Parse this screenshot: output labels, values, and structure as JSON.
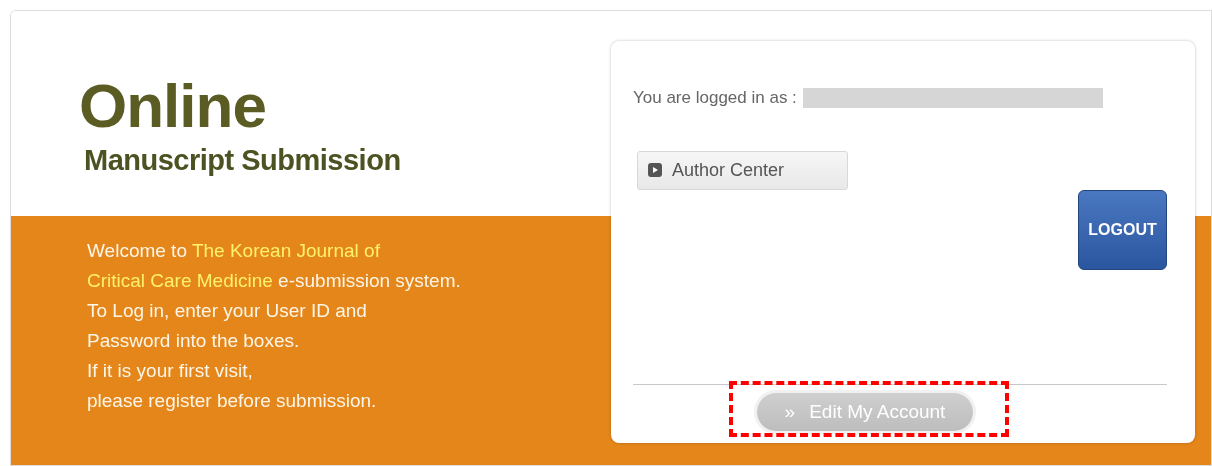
{
  "header": {
    "title": "Online",
    "subtitle": "Manuscript Submission"
  },
  "welcome": [
    [
      {
        "text": "Welcome to ",
        "highlight": false
      },
      {
        "text": "The Korean Journal of",
        "highlight": true
      }
    ],
    [
      {
        "text": "Critical Care Medicine",
        "highlight": true
      },
      {
        "text": " e-submission system.",
        "highlight": false
      }
    ],
    [
      {
        "text": "To Log in, enter your User ID and",
        "highlight": false
      }
    ],
    [
      {
        "text": "Password into the boxes.",
        "highlight": false
      }
    ],
    [
      {
        "text": "If it is your first visit,",
        "highlight": false
      }
    ],
    [
      {
        "text": "please register before submission.",
        "highlight": false
      }
    ]
  ],
  "login_panel": {
    "logged_in_label": "You are logged in as :",
    "author_center": "Author Center",
    "logout": "LOGOUT",
    "edit_account": {
      "icon": "»",
      "label": "Edit My Account",
      "highlighted": true
    }
  }
}
